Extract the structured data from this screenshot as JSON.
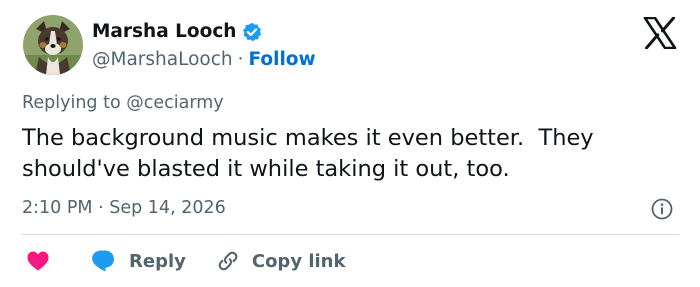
{
  "author": {
    "display_name": "Marsha Looch",
    "handle": "@MarshaLooch",
    "separator": "·",
    "follow_label": "Follow",
    "verified": true
  },
  "reply_context": {
    "prefix": "Replying to",
    "mention": "@ceciarmy"
  },
  "tweet": {
    "text": "The background music makes it even better.  They should've blasted it while taking it out, too.",
    "time": "2:10 PM",
    "separator": "·",
    "date": "Sep 14, 2026"
  },
  "actions": {
    "reply_label": "Reply",
    "copy_link_label": "Copy link"
  },
  "colors": {
    "brand_blue": "#1d9bf0",
    "follow_text": "#006fd6",
    "like_pink": "#f91880",
    "muted_text": "#536471",
    "divider": "#cfd9de"
  },
  "icons": [
    "verified-badge-icon",
    "x-logo-icon",
    "info-icon",
    "heart-icon",
    "reply-bubble-icon",
    "link-icon"
  ]
}
